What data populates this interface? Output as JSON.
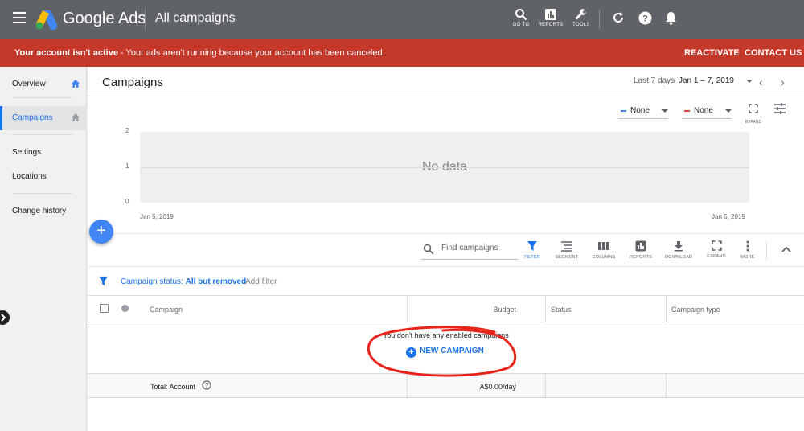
{
  "topbar": {
    "brand": "Google Ads",
    "page_name": "All campaigns",
    "tools": [
      {
        "label": "GO TO",
        "icon": "search-icon"
      },
      {
        "label": "REPORTS",
        "icon": "reports-icon"
      },
      {
        "label": "TOOLS",
        "icon": "wrench-icon"
      }
    ]
  },
  "banner": {
    "bold": "Your account isn't active",
    "text": " - Your ads aren't running because your account has been canceled.",
    "reactivate": "REACTIVATE",
    "contact": "CONTACT US"
  },
  "sidebar": {
    "items": [
      {
        "label": "Overview"
      },
      {
        "label": "Campaigns"
      },
      {
        "label": "Settings"
      },
      {
        "label": "Locations"
      },
      {
        "label": "Change history"
      }
    ]
  },
  "header": {
    "title": "Campaigns",
    "range_label": "Last 7 days",
    "range_value": "Jan 1 – 7, 2019"
  },
  "chart": {
    "metric1": "None",
    "metric2": "None",
    "expand_label": "EXPAND",
    "no_data": "No data",
    "colors": {
      "metric1": "#4285f4",
      "metric2": "#db4437"
    }
  },
  "chart_data": {
    "type": "line",
    "title": "",
    "x": [
      "Jan 5, 2019",
      "Jan 6, 2019"
    ],
    "series": [],
    "yticks": [
      "2",
      "1",
      "0"
    ],
    "ylim": [
      0,
      2
    ],
    "grid": true,
    "annotation": "No data"
  },
  "toolbar": {
    "search_placeholder": "Find campaigns",
    "buttons": [
      {
        "label": "FILTER",
        "icon": "filter-icon"
      },
      {
        "label": "SEGMENT",
        "icon": "segment-icon"
      },
      {
        "label": "COLUMNS",
        "icon": "columns-icon"
      },
      {
        "label": "REPORTS",
        "icon": "reports-icon"
      },
      {
        "label": "DOWNLOAD",
        "icon": "download-icon"
      },
      {
        "label": "EXPAND",
        "icon": "expand-icon"
      },
      {
        "label": "MORE",
        "icon": "more-icon"
      }
    ]
  },
  "filter": {
    "prefix": "Campaign status: ",
    "value": "All but removed",
    "add": "Add filter"
  },
  "table": {
    "columns": [
      "Campaign",
      "Budget",
      "Status",
      "Campaign type"
    ],
    "empty_message": "You don't have any enabled campaigns",
    "new_campaign": "NEW CAMPAIGN",
    "total_label": "Total: Account",
    "total_budget": "A$0.00/day"
  }
}
